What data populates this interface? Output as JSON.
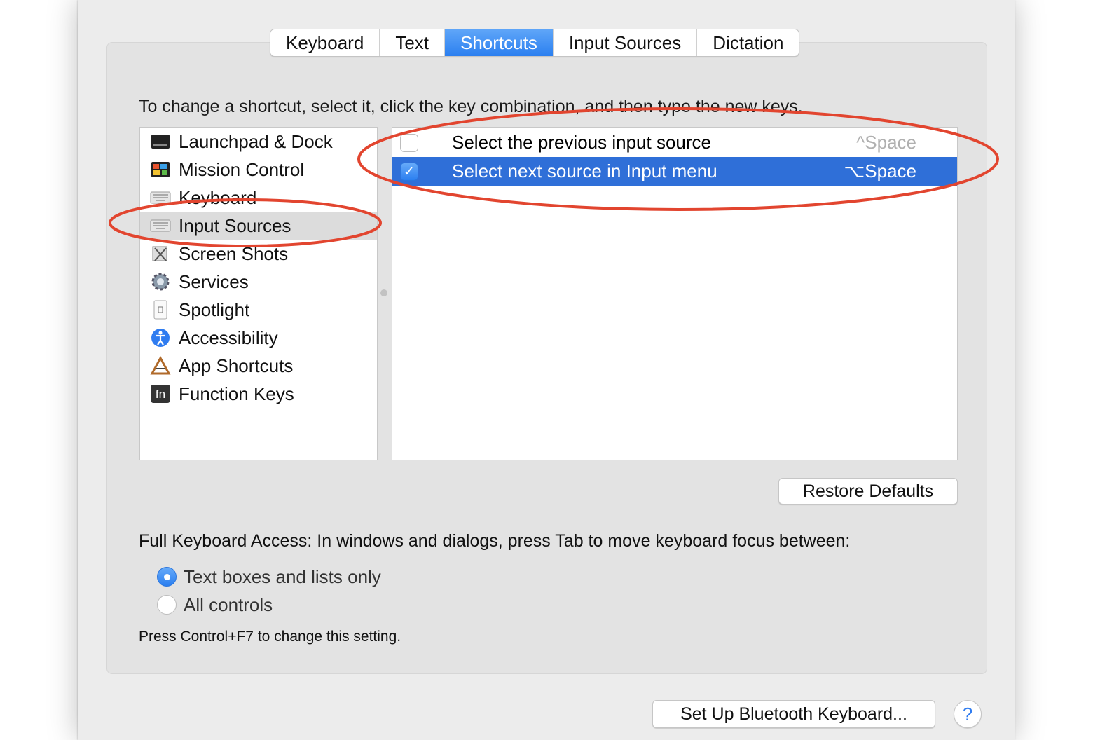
{
  "tabs": [
    {
      "label": "Keyboard",
      "selected": false
    },
    {
      "label": "Text",
      "selected": false
    },
    {
      "label": "Shortcuts",
      "selected": true
    },
    {
      "label": "Input Sources",
      "selected": false
    },
    {
      "label": "Dictation",
      "selected": false
    }
  ],
  "instruction": "To change a shortcut, select it, click the key combination, and then type the new keys.",
  "categories": [
    {
      "label": "Launchpad & Dock",
      "icon": "launchpad-icon"
    },
    {
      "label": "Mission Control",
      "icon": "mission-control-icon"
    },
    {
      "label": "Keyboard",
      "icon": "keyboard-icon"
    },
    {
      "label": "Input Sources",
      "icon": "keyboard-icon",
      "selected": true
    },
    {
      "label": "Screen Shots",
      "icon": "screenshot-icon"
    },
    {
      "label": "Services",
      "icon": "gear-icon"
    },
    {
      "label": "Spotlight",
      "icon": "spotlight-icon"
    },
    {
      "label": "Accessibility",
      "icon": "accessibility-icon"
    },
    {
      "label": "App Shortcuts",
      "icon": "app-shortcuts-icon"
    },
    {
      "label": "Function Keys",
      "icon": "fn-icon"
    }
  ],
  "shortcuts": [
    {
      "description": "Select the previous input source",
      "key": "^Space",
      "checked": false,
      "selected": false
    },
    {
      "description": "Select next source in Input menu",
      "key": "⌥Space",
      "checked": true,
      "selected": true
    }
  ],
  "restore_defaults": "Restore Defaults",
  "full_keyboard_access": {
    "label": "Full Keyboard Access: In windows and dialogs, press Tab to move keyboard focus between:",
    "options": [
      {
        "label": "Text boxes and lists only",
        "selected": true
      },
      {
        "label": "All controls",
        "selected": false
      }
    ],
    "hint": "Press Control+F7 to change this setting."
  },
  "bluetooth_button": "Set Up Bluetooth Keyboard...",
  "help_button": "?",
  "colors": {
    "accent": "#2b7ff0",
    "selection": "#2f6fd8",
    "annotation": "#e2452f"
  }
}
